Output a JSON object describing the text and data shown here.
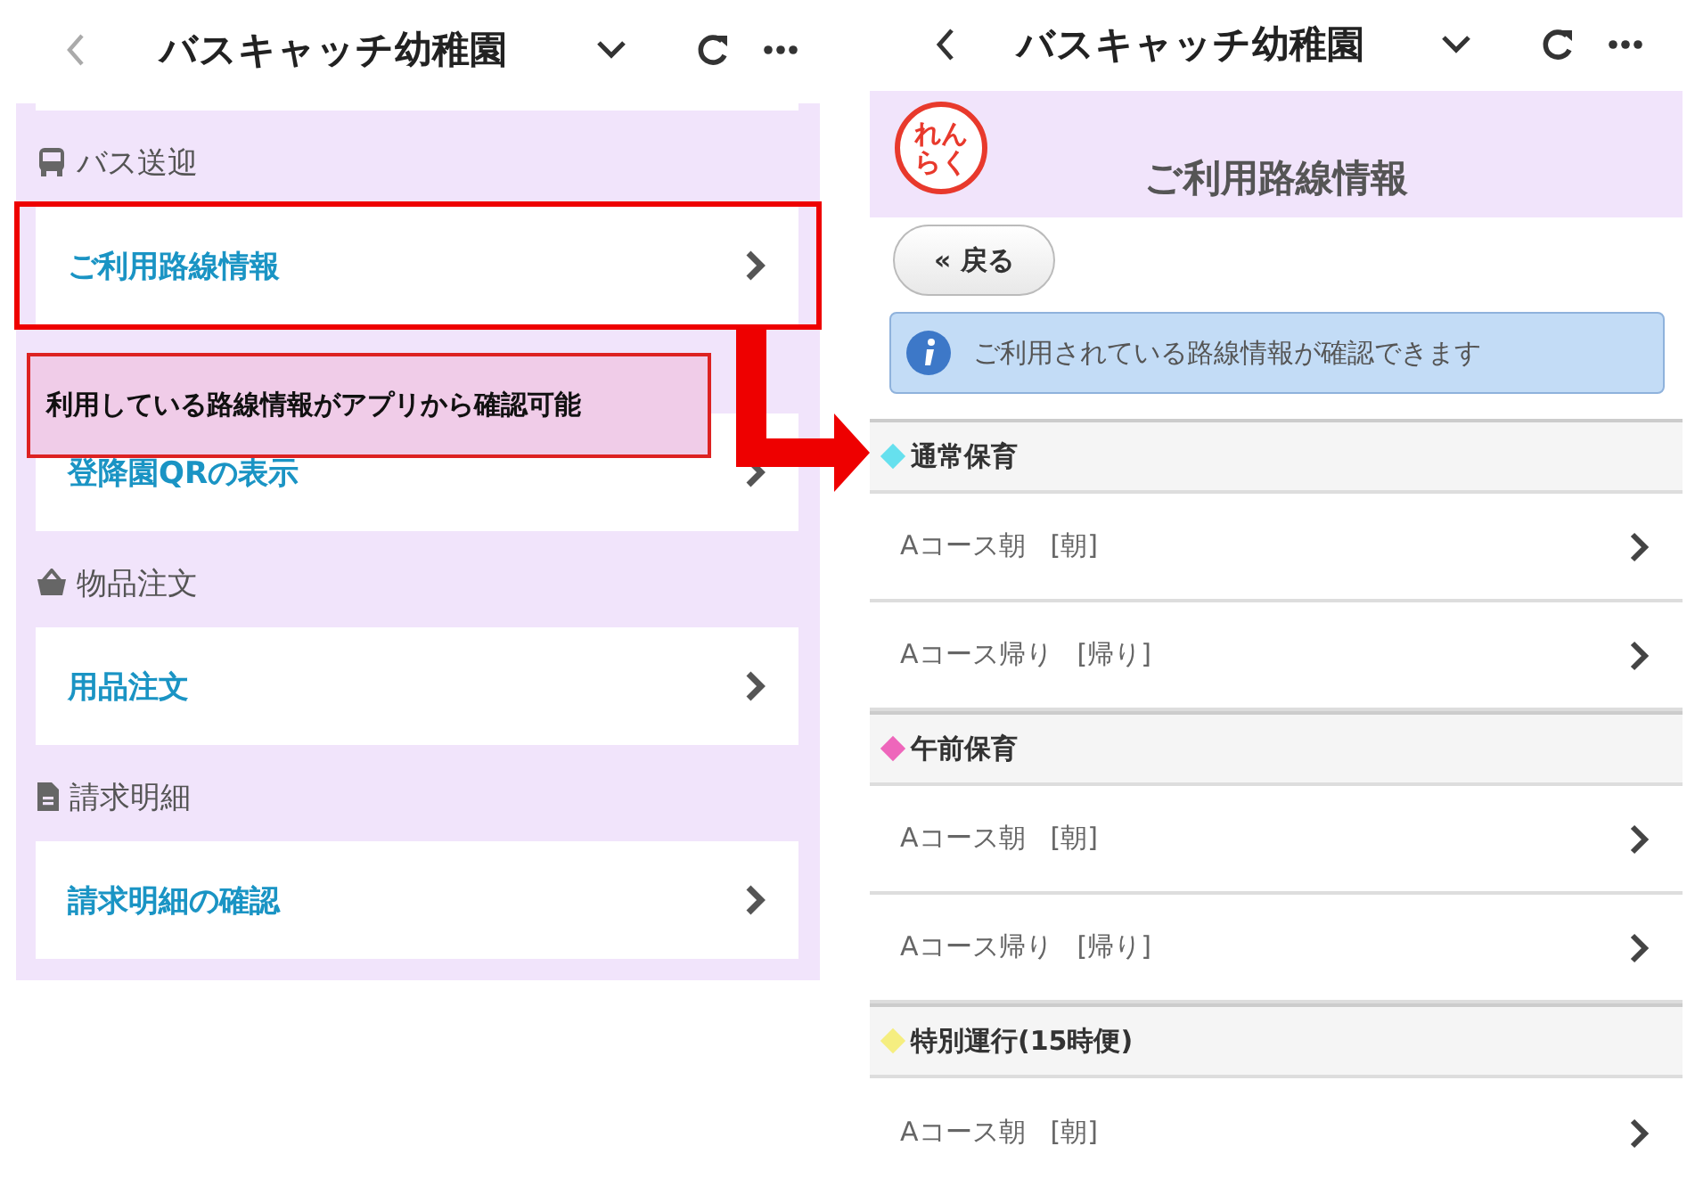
{
  "left_screen": {
    "header": {
      "title": "バスキャッチ幼稚園"
    },
    "sections": [
      {
        "title": "バス送迎",
        "items": [
          {
            "label": "ご利用路線情報"
          },
          {
            "label": "登降園QRの表示"
          }
        ]
      },
      {
        "title": "物品注文",
        "items": [
          {
            "label": "用品注文"
          }
        ]
      },
      {
        "title": "請求明細",
        "items": [
          {
            "label": "請求明細の確認"
          }
        ]
      }
    ]
  },
  "right_screen": {
    "header": {
      "title": "バスキャッチ幼稚園"
    },
    "logo": [
      "れん",
      "らく"
    ],
    "page_title": "ご利用路線情報",
    "back_button": "« 戻る",
    "info": "ご利用されている路線情報が確認できます",
    "groups": [
      {
        "title": "通常保育",
        "color": "#66e0ee",
        "rows": [
          {
            "label": "Aコース朝",
            "tag": "[朝]"
          },
          {
            "label": "Aコース帰り",
            "tag": "[帰り]"
          }
        ]
      },
      {
        "title": "午前保育",
        "color": "#ee66bb",
        "rows": [
          {
            "label": "Aコース朝",
            "tag": "[朝]"
          },
          {
            "label": "Aコース帰り",
            "tag": "[帰り]"
          }
        ]
      },
      {
        "title": "特別運行(15時便)",
        "color": "#f5ee80",
        "rows": [
          {
            "label": "Aコース朝",
            "tag": "[朝]"
          }
        ]
      }
    ]
  },
  "annotation": {
    "callout": "利用している路線情報がアプリから確認可能"
  }
}
